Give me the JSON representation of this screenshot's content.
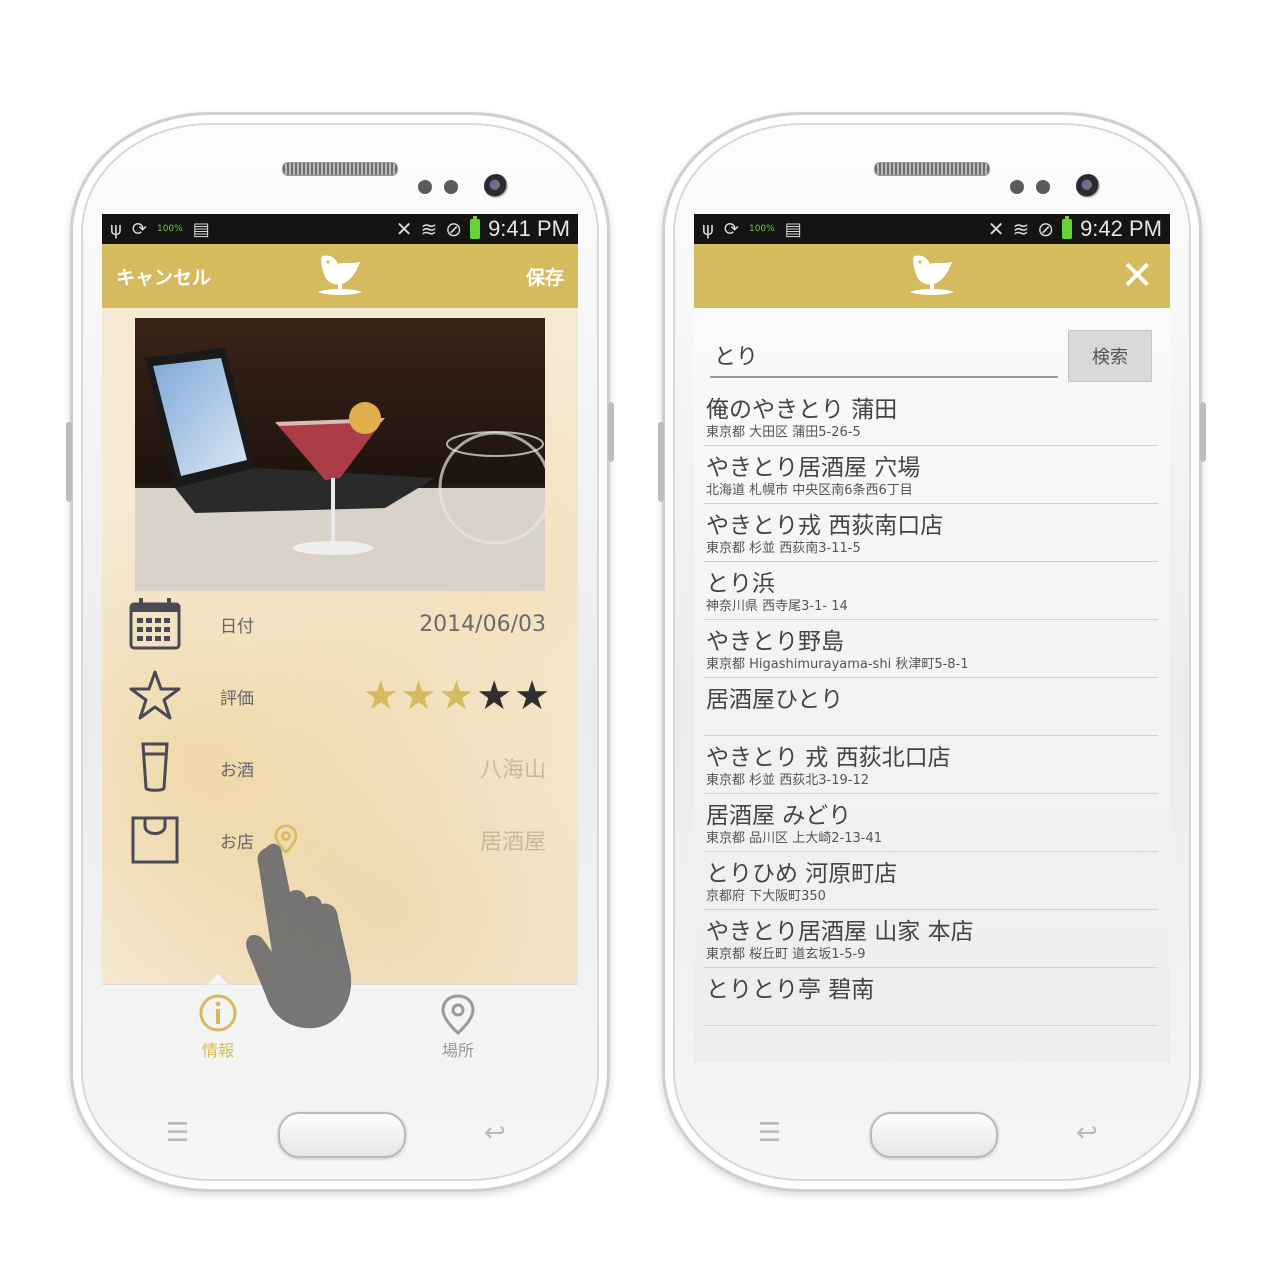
{
  "left": {
    "status": {
      "time": "9:41 PM",
      "battery_text": "100%"
    },
    "actionbar": {
      "cancel": "キャンセル",
      "save": "保存"
    },
    "fields": {
      "date": {
        "label": "日付",
        "value": "2014/06/03"
      },
      "rating": {
        "label": "評価",
        "value": 3,
        "max": 5
      },
      "drink": {
        "label": "お酒",
        "placeholder": "八海山"
      },
      "shop": {
        "label": "お店",
        "placeholder": "居酒屋"
      }
    },
    "tabs": {
      "info": "情報",
      "place": "場所"
    },
    "colors": {
      "accent": "#d5bb5d"
    }
  },
  "right": {
    "status": {
      "time": "9:42 PM",
      "battery_text": "100%"
    },
    "search": {
      "value": "とり",
      "button": "検索"
    },
    "results": [
      {
        "name": "俺のやきとり 蒲田",
        "address": "東京都 大田区 蒲田5-26-5"
      },
      {
        "name": "やきとり居酒屋 穴場",
        "address": "北海道 札幌市 中央区南6条西6丁目"
      },
      {
        "name": "やきとり戎 西荻南口店",
        "address": "東京都 杉並 西荻南3-11-5"
      },
      {
        "name": "とり浜",
        "address": "神奈川県 西寺尾3-1- 14"
      },
      {
        "name": "やきとり野島",
        "address": "東京都 Higashimurayama-shi 秋津町5-8-1"
      },
      {
        "name": "居酒屋ひとり",
        "address": ""
      },
      {
        "name": "やきとり 戎 西荻北口店",
        "address": "東京都 杉並 西荻北3-19-12"
      },
      {
        "name": "居酒屋 みどり",
        "address": "東京都 品川区 上大崎2-13-41"
      },
      {
        "name": "とりひめ 河原町店",
        "address": "京都府 下大阪町350"
      },
      {
        "name": "やきとり居酒屋 山家 本店",
        "address": "東京都 桜丘町 道玄坂1-5-9"
      },
      {
        "name": "とりとり亭 碧南",
        "address": ""
      }
    ]
  }
}
